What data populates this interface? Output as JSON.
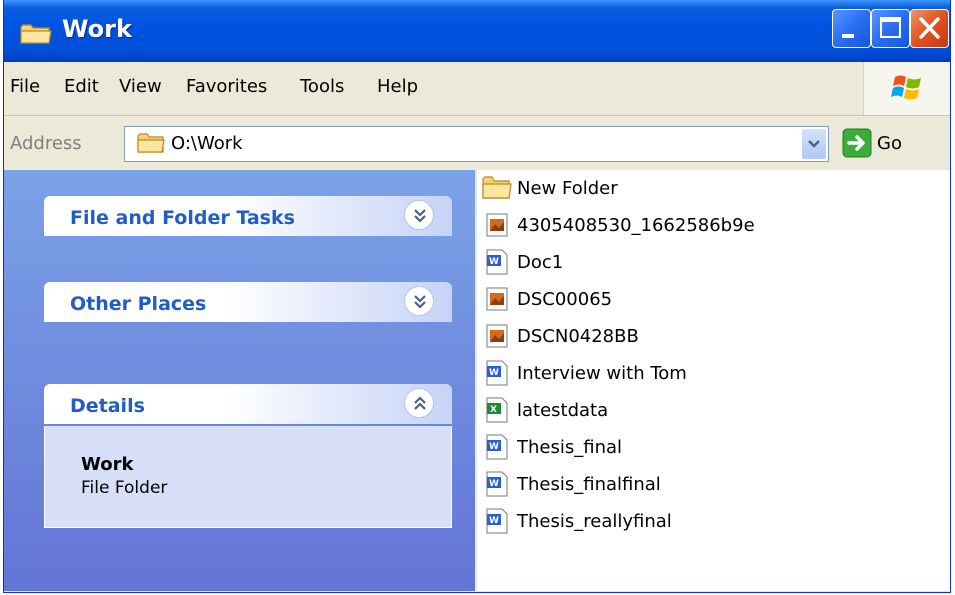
{
  "window": {
    "title": "Work",
    "controls": [
      "minimize-icon",
      "maximize-icon",
      "close-icon"
    ]
  },
  "menu": [
    "File",
    "Edit",
    "View",
    "Favorites",
    "Tools",
    "Help"
  ],
  "address": {
    "label": "Address",
    "value": "O:\\Work",
    "go_label": "Go"
  },
  "taskpane": {
    "panels": [
      {
        "title": "File and Folder Tasks",
        "state": "collapsed"
      },
      {
        "title": "Other Places",
        "state": "collapsed"
      },
      {
        "title": "Details",
        "state": "expanded"
      }
    ],
    "details": {
      "name": "Work",
      "type": "File Folder"
    }
  },
  "files": [
    {
      "name": "New Folder",
      "icon": "folder-icon"
    },
    {
      "name": "4305408530_1662586b9e",
      "icon": "image-file-icon"
    },
    {
      "name": "Doc1",
      "icon": "word-doc-icon"
    },
    {
      "name": "DSC00065",
      "icon": "image-file-icon"
    },
    {
      "name": "DSCN0428BB",
      "icon": "image-file-icon"
    },
    {
      "name": "Interview with Tom",
      "icon": "word-doc-icon"
    },
    {
      "name": "latestdata",
      "icon": "excel-file-icon"
    },
    {
      "name": "Thesis_final",
      "icon": "word-doc-icon"
    },
    {
      "name": "Thesis_finalfinal",
      "icon": "word-doc-icon"
    },
    {
      "name": "Thesis_reallyfinal",
      "icon": "word-doc-icon"
    }
  ],
  "colors": {
    "titlebar": "#0054e3",
    "taskpane_top": "#7ba2e7",
    "taskpane_bottom": "#6375d6",
    "panel_title": "#215dc6",
    "close_button": "#e0521f"
  }
}
